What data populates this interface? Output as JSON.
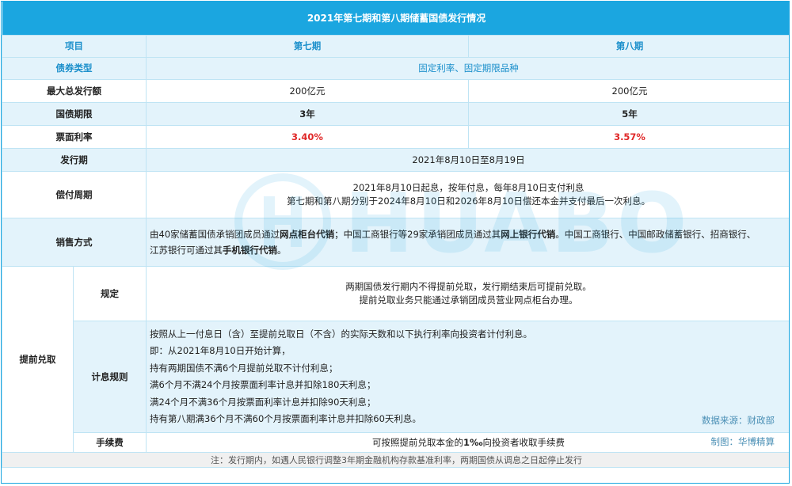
{
  "title": "2021年第七期和第八期储蓄国债发行情况",
  "header": {
    "col_item": "项目",
    "col_seven": "第七期",
    "col_eight": "第八期"
  },
  "rows": {
    "bond_type": {
      "label": "债券类型",
      "value": "固定利率、固定期限品种"
    },
    "max_amount": {
      "label": "最大总发行额",
      "seven": "200亿元",
      "eight": "200亿元"
    },
    "term": {
      "label": "国债期限",
      "seven": "3年",
      "eight": "5年"
    },
    "coupon": {
      "label": "票面利率",
      "seven": "3.40%",
      "eight": "3.57%"
    },
    "issue_period": {
      "label": "发行期",
      "value": "2021年8月10日至8月19日"
    },
    "payment": {
      "label": "偿付周期",
      "line1": "2021年8月10日起息，按年付息，每年8月10日支付利息",
      "line2": "第七期和第八期分别于2024年8月10日和2026年8月10日偿还本金并支付最后一次利息。"
    },
    "sales": {
      "label": "销售方式",
      "p1": "由40家储蓄国债承销团成员通过",
      "b1": "网点柜台代销",
      "p2": "；中国工商银行等29家承销团成员通过其",
      "b2": "网上银行代销",
      "p3": "。中国工商银行、中国邮政储蓄银行、招商银行、",
      "p4": "江苏银行可通过其",
      "b3": "手机银行代销",
      "p5": "。"
    },
    "redemption": {
      "label": "提前兑取",
      "rule": {
        "label": "规定",
        "line1": "两期国债发行期内不得提前兑取，发行期结束后可提前兑取。",
        "line2": "提前兑取业务只能通过承销团成员营业网点柜台办理。"
      },
      "interest": {
        "label": "计息规则",
        "lines": [
          "按照从上一付息日（含）至提前兑取日（不含）的实际天数和以下执行利率向投资者计付利息。",
          "即：从2021年8月10日开始计算，",
          "持有两期国债不满6个月提前兑取不计付利息；",
          "满6个月不满24个月按票面利率计息并扣除180天利息；",
          "满24个月不满36个月按票面利率计息并扣除90天利息；",
          "持有第八期满36个月不满60个月按票面利率计息并扣除60天利息。"
        ]
      },
      "fee": {
        "label": "手续费",
        "p1": "可按照提前兑取本金的",
        "b1": "1‰",
        "p2": "向投资者收取手续费"
      }
    }
  },
  "source": {
    "data": "数据来源：财政部",
    "author": "制图：华博精算"
  },
  "note": "注：发行期内，如遇人民银行调整3年期金融机构存款基准利率，两期国债从调息之日起停止发行",
  "watermark": {
    "text": "HUABO"
  },
  "colors": {
    "accent": "#1ba6e0",
    "red": "#e02828",
    "row_blue": "#e3f3fb",
    "border": "#bfe4f4"
  }
}
